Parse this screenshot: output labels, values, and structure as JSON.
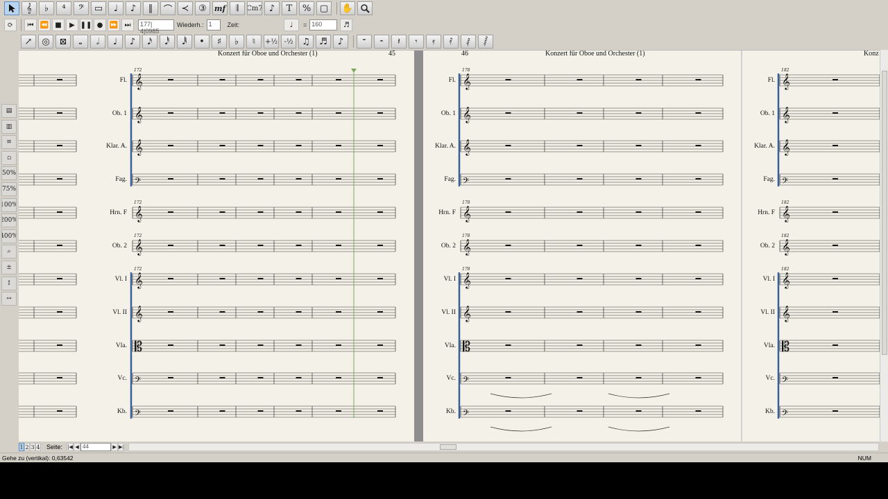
{
  "toolbar_row1": {
    "icons": [
      "select-arrow-icon",
      "treble-clef-icon",
      "key-signature-icon",
      "time-signature-icon",
      "bass-clef-icon",
      "rest-icon",
      "quarter-note-icon",
      "eighth-note-icon",
      "voice-icon",
      "slur-icon",
      "hairpin-icon",
      "tuplet-icon",
      "dynamics-icon",
      "barline-icon",
      "chord-symbol-icon",
      "grace-note-icon",
      "text-icon",
      "percent-icon",
      "page-icon",
      "hand-icon",
      "zoom-icon"
    ],
    "dynamic_label": "mf",
    "chord_label": "Cm7",
    "text_label": "T",
    "percent_label": "%"
  },
  "transport": {
    "position_value": "177| 4|0985",
    "repeat_label": "Wiederh.:",
    "repeat_value": "1",
    "time_label": "Zeit:",
    "tempo_value": "160",
    "equals_label": "="
  },
  "toolbar_row3": {
    "icons": [
      "articulation-icon",
      "tie-icon",
      "beam-icon",
      "whole-note-icon",
      "half-note-icon",
      "quarter-note-icon",
      "eighth-note-icon",
      "sixteenth-note-icon",
      "thirtysecond-note-icon",
      "sixtyfourth-note-icon",
      "dot-icon",
      "sharp-icon",
      "flat-icon",
      "natural-icon",
      "octave-up-icon",
      "octave-down-icon",
      "eighth-pair-icon",
      "beamed-sixteenths-icon",
      "tuplet-note-icon",
      "whole-rest-icon",
      "half-rest-icon",
      "quarter-rest-icon",
      "eighth-rest-icon",
      "sixteenth-rest-icon",
      "thirtysecond-rest-icon",
      "sixtyfourth-rest-icon",
      "onetwentyeighth-rest-icon"
    ],
    "octave_up_label": "+½",
    "octave_down_label": "-½"
  },
  "left_palette": {
    "icons": [
      "page-view-icon",
      "part-view-icon",
      "staff-view-icon",
      "fit-icon",
      "zoom-50-icon",
      "zoom-75-icon",
      "zoom-100-icon",
      "zoom-200-icon",
      "zoom-400-icon",
      "zoom-tool-icon",
      "zoom-in-out-icon",
      "vertical-fit-icon",
      "horizontal-fit-icon"
    ],
    "zoom_labels": [
      "50%",
      "75%",
      "100%",
      "200%",
      "400%"
    ]
  },
  "score": {
    "title": "Konzert für Oboe und Orchester (1)",
    "title_partial": "Konz",
    "page_left_number": "45",
    "page_right_number": "46",
    "instruments": [
      "Fl.",
      "Ob. 1",
      "Klar. A.",
      "Fag.",
      "Hrn. F",
      "Ob. 2",
      "Vl. I",
      "Vl. II",
      "Vla.",
      "Vc.",
      "Kb."
    ],
    "measure_numbers": [
      "172",
      "178",
      "182"
    ]
  },
  "bottom_bar": {
    "layer_tabs": [
      "1",
      "2",
      "3",
      "4"
    ],
    "page_label": "Seite:",
    "page_value": "44"
  },
  "status_bar": {
    "message": "Gehe zu (vertikal): 0,63542",
    "num_indicator": "NUM"
  },
  "colors": {
    "paper": "#f4f2e8",
    "chrome": "#d4d0c8",
    "playhead": "#7aa85a",
    "system_bracket": "#3a5e9a",
    "selection": "#b8d4f0"
  }
}
